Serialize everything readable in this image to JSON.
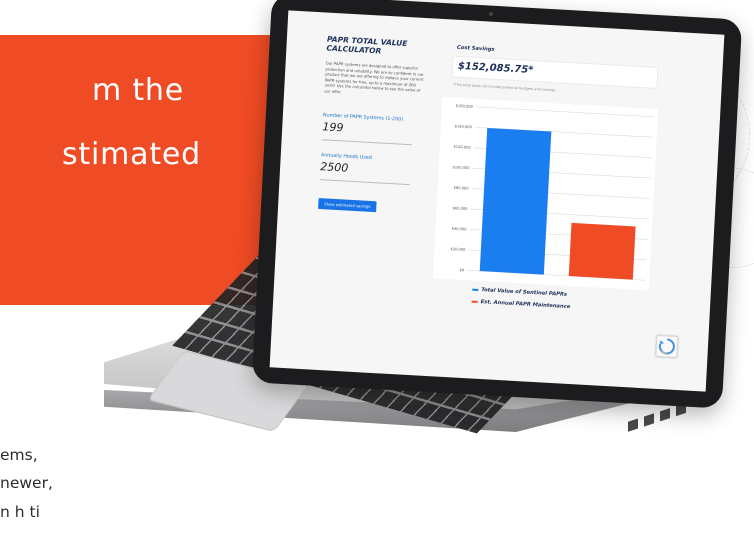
{
  "promo": {
    "line1": "m the",
    "line2": "stimated"
  },
  "body_text": {
    "line1": "ems,",
    "line2": "newer,",
    "line3": "n h        ti"
  },
  "calculator": {
    "title": "PAPR TOTAL VALUE CALCULATOR",
    "description": "Our PAPR systems are designed to offer superior protection and reliability. We are so confident in our product that we are offering to replace your current PAPR systems for free, up to a maximum of 200 units! Use the calculator below to see the value of our offer.",
    "field1_label": "Number of PAPR Systems (1-200)",
    "field1_value": "199",
    "field2_label": "Annually Hoods Used",
    "field2_value": "2500",
    "button_label": "Show estimated savings"
  },
  "savings": {
    "label": "Cost Savings",
    "value": "$152,085.75*",
    "note": "*This total does not include potential budgets and savings."
  },
  "chart_data": {
    "type": "bar",
    "categories": [
      "Total Value of Sentinel PAPRs",
      "Est. Annual PAPR Maintenance"
    ],
    "series": [
      {
        "name": "Total Value of Sentinel PAPRs",
        "values": [
          140000,
          0
        ],
        "color": "#1a7ef0"
      },
      {
        "name": "Est. Annual PAPR Maintenance",
        "values": [
          0,
          52000
        ],
        "color": "#ef4b24"
      }
    ],
    "ylim": [
      0,
      160000
    ],
    "y_ticks": [
      "$0",
      "$20,000",
      "$40,000",
      "$60,000",
      "$80,000",
      "$100,000",
      "$120,000",
      "$140,000",
      "$160,000"
    ],
    "tick_values": [
      0,
      20000,
      40000,
      60000,
      80000,
      100000,
      120000,
      140000,
      160000
    ],
    "grid": true,
    "legend_placement": "bottom"
  },
  "legend": {
    "item1": "Total Value of Sentinel PAPRs",
    "item2": "Est. Annual PAPR Maintenance"
  },
  "colors": {
    "brand_orange": "#ef4b24",
    "bar_blue": "#1a7ef0",
    "navy": "#1b2f5a"
  },
  "icons": {
    "recaptcha": "recaptcha-icon"
  }
}
